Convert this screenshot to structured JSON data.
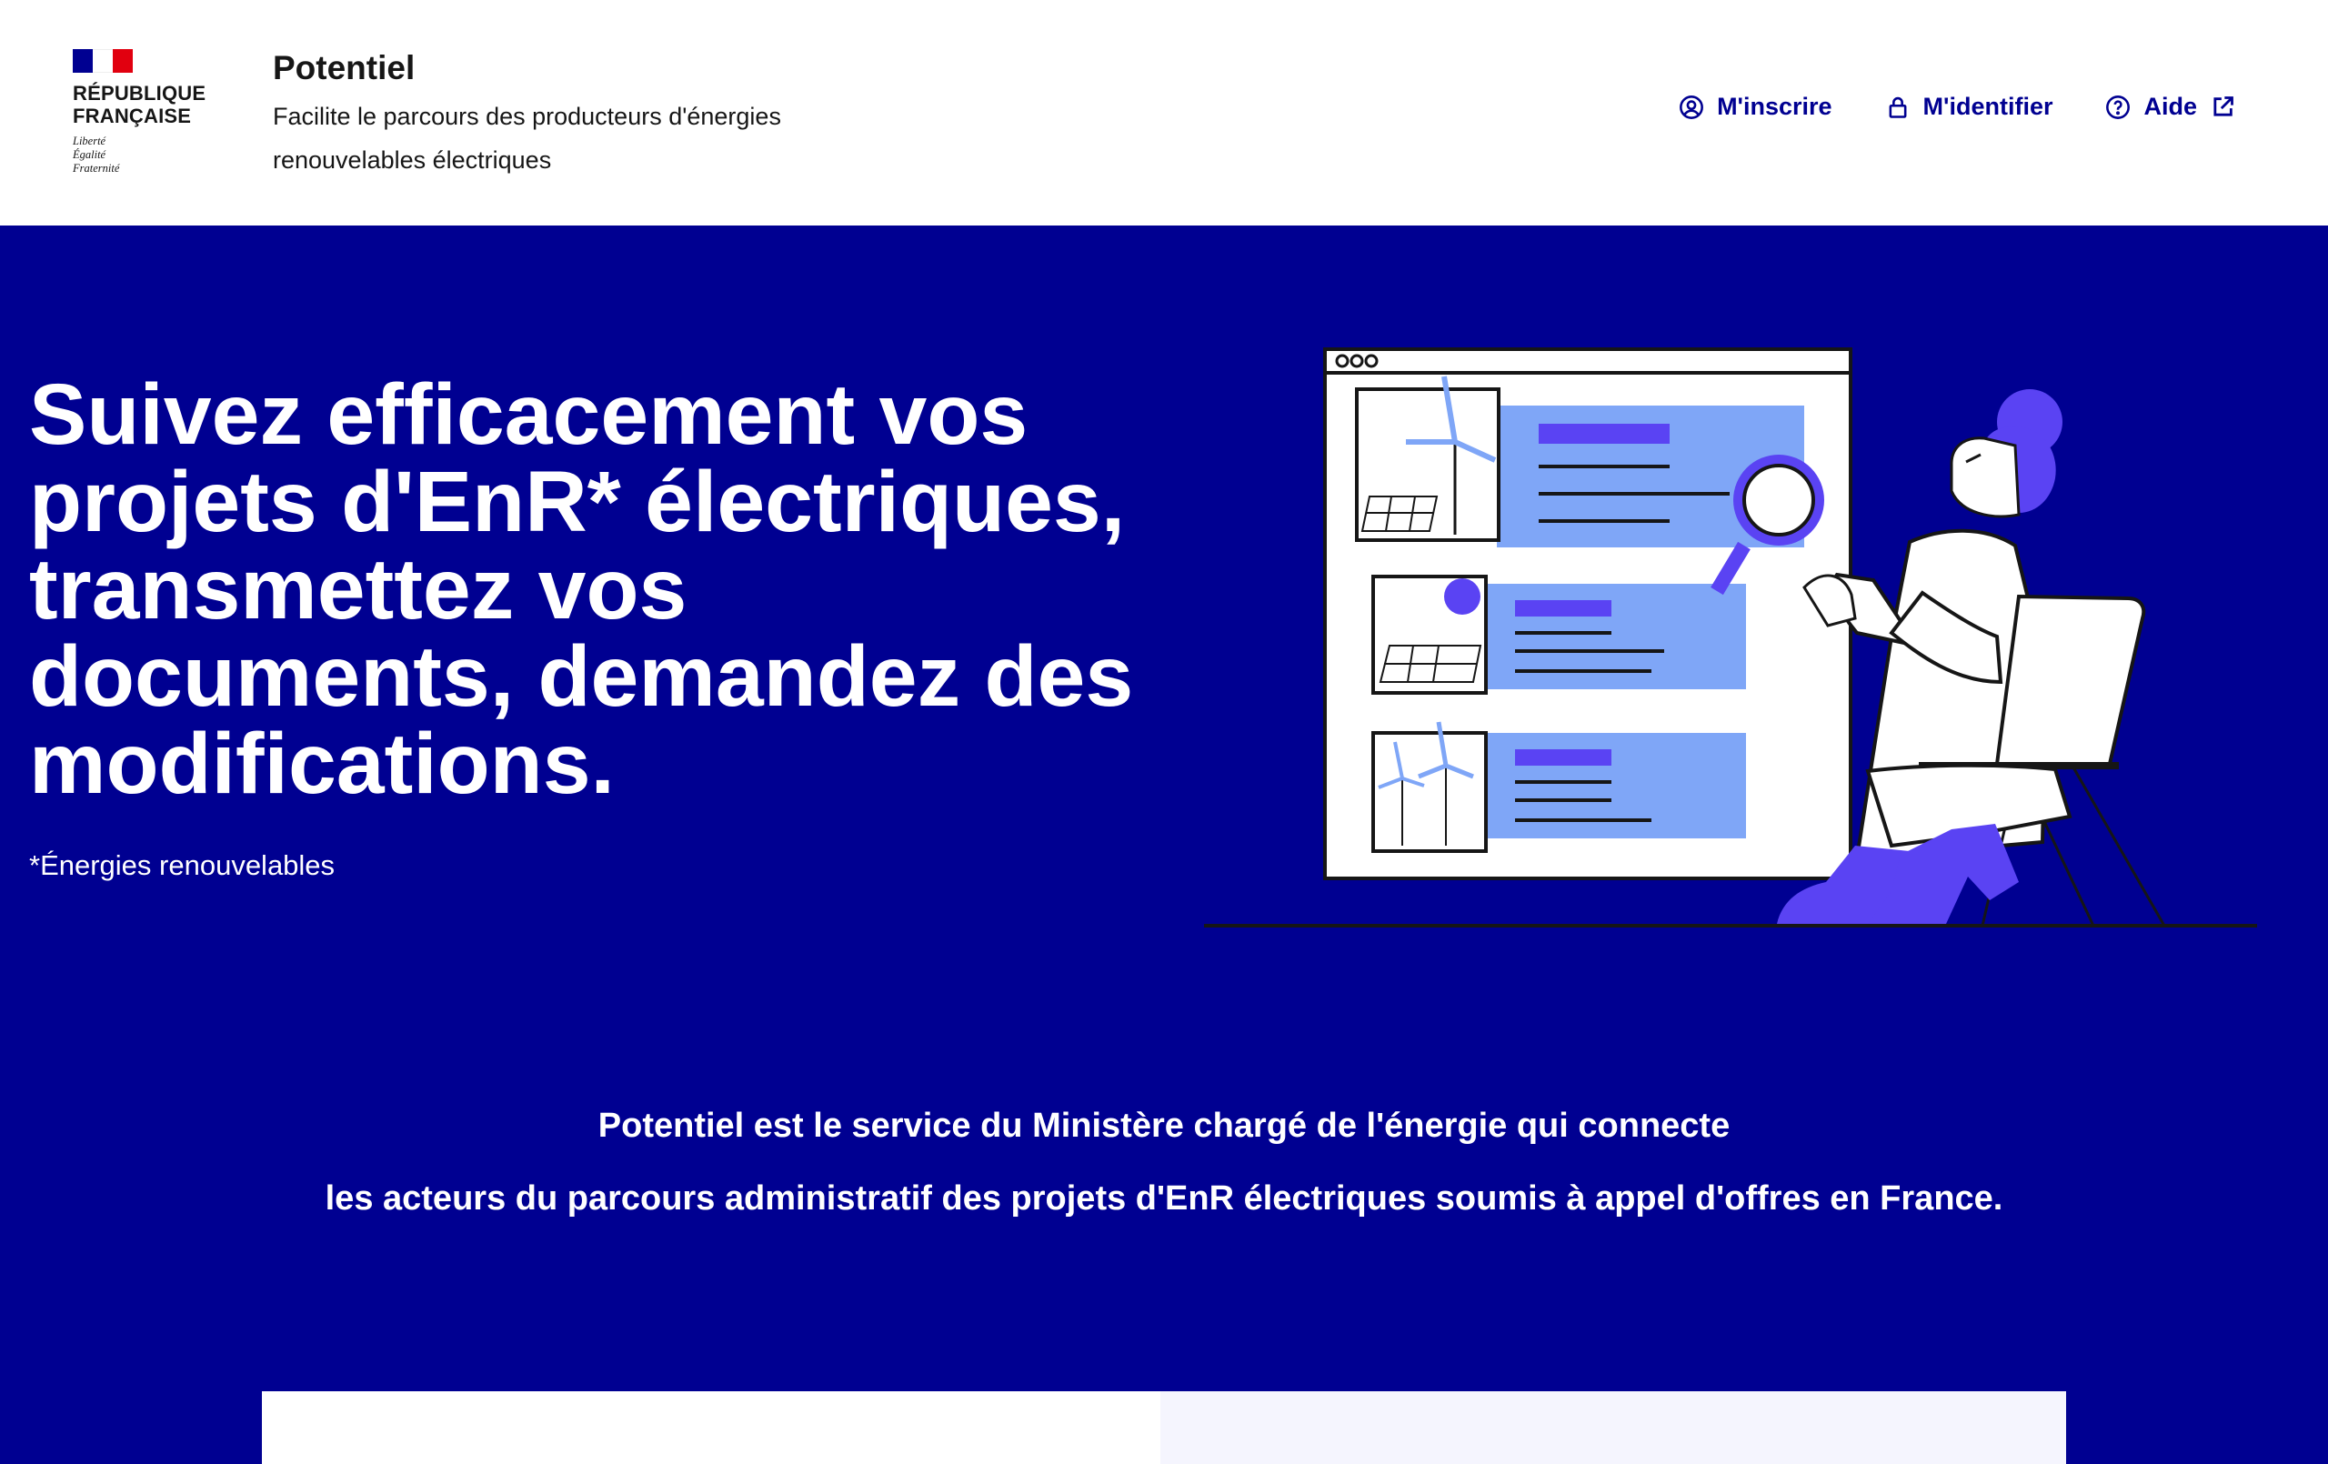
{
  "header": {
    "republic_line1": "RÉPUBLIQUE",
    "republic_line2": "FRANÇAISE",
    "motto": [
      "Liberté",
      "Égalité",
      "Fraternité"
    ],
    "service_title": "Potentiel",
    "service_tagline": "Facilite le parcours des producteurs d'énergies renouvelables électriques",
    "links": [
      {
        "label": "M'inscrire",
        "icon": "account-circle-icon"
      },
      {
        "label": "M'identifier",
        "icon": "lock-icon"
      },
      {
        "label": "Aide",
        "icon": "question-circle-icon",
        "external_icon": "external-link-icon"
      }
    ]
  },
  "hero": {
    "title": "Suivez efficacement vos projets d'EnR* électriques, transmettez vos documents, demandez des modifications.",
    "footnote": "*Énergies renouvelables"
  },
  "intro": {
    "line1": "Potentiel est le service du Ministère chargé de l'énergie qui connecte",
    "line2": "les acteurs du parcours administratif des projets d'EnR électriques soumis à appel d'offres en France."
  },
  "colors": {
    "primary": "#000091",
    "accent_light": "#7fa6f7",
    "accent_violet": "#5a43f3",
    "flag_red": "#e1000f"
  }
}
